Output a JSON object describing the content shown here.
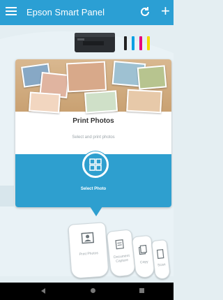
{
  "app_bar": {
    "title": "Epson Smart Panel",
    "menu_icon": "hamburger-menu-icon",
    "refresh_icon": "refresh-icon",
    "add_icon": "plus-icon"
  },
  "printer": {
    "ink_colors": [
      "#222222",
      "#00a0e3",
      "#e5007e",
      "#f5d800"
    ]
  },
  "card": {
    "title": "Print Photos",
    "subtitle": "Select and print photos",
    "action_label": "Select Photo",
    "action_icon": "photo-grid-icon"
  },
  "carousel": {
    "items": [
      {
        "label": "Print Photos",
        "icon": "photo-icon"
      },
      {
        "label": "Document Capture",
        "icon": "document-icon"
      },
      {
        "label": "Copy",
        "icon": "copy-icon"
      },
      {
        "label": "Scan",
        "icon": "scan-icon"
      }
    ]
  },
  "colors": {
    "accent": "#2b9fd4",
    "background": "#e4eef2"
  }
}
